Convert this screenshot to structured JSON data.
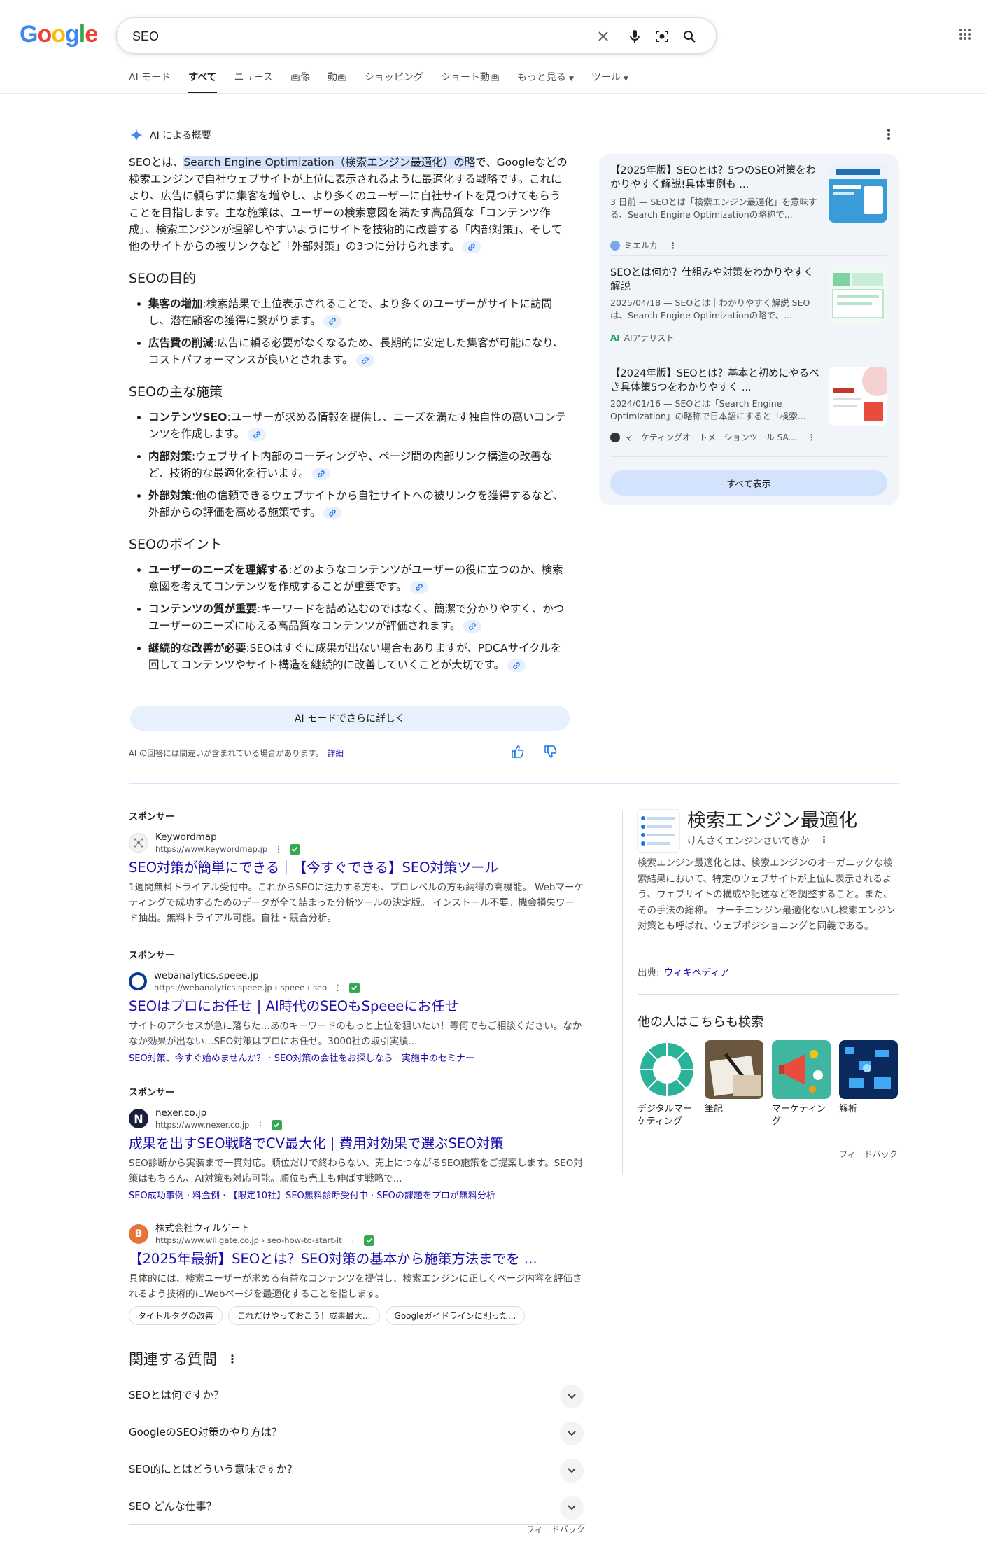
{
  "header": {
    "logo": "Google",
    "query": "SEO",
    "tabs": [
      "AI モード",
      "すべて",
      "ニュース",
      "画像",
      "動画",
      "ショッピング",
      "ショート動画",
      "もっと見る",
      "ツール"
    ]
  },
  "ai_overview": {
    "label": "AI による概要",
    "intro_pre": "SEOとは、",
    "intro_hl": "Search Engine Optimization（検索エンジン最適化）の略",
    "intro_post": "で、Googleなどの検索エンジンで自社ウェブサイトが上位に表示されるように最適化する戦略です。これにより、広告に頼らずに集客を増やし、より多くのユーザーに自社サイトを見つけてもらうことを目指します。主な施策は、ユーザーの検索意図を満たす高品質な「コンテンツ作成」、検索エンジンが理解しやすいようにサイトを技術的に改善する「内部対策」、そして他のサイトからの被リンクなど「外部対策」の3つに分けられます。",
    "sections": [
      {
        "heading": "SEOの目的",
        "items": [
          {
            "term": "集客の増加",
            "text": ":検索結果で上位表示されることで、より多くのユーザーがサイトに訪問し、潜在顧客の獲得に繋がります。"
          },
          {
            "term": "広告費の削減",
            "text": ":広告に頼る必要がなくなるため、長期的に安定した集客が可能になり、コストパフォーマンスが良いとされます。"
          }
        ]
      },
      {
        "heading": "SEOの主な施策",
        "items": [
          {
            "term": "コンテンツSEO",
            "text": ":ユーザーが求める情報を提供し、ニーズを満たす独自性の高いコンテンツを作成します。"
          },
          {
            "term": "内部対策",
            "text": ":ウェブサイト内部のコーディングや、ページ間の内部リンク構造の改善など、技術的な最適化を行います。"
          },
          {
            "term": "外部対策",
            "text": ":他の信頼できるウェブサイトから自社サイトへの被リンクを獲得するなど、外部からの評価を高める施策です。"
          }
        ]
      },
      {
        "heading": "SEOのポイント",
        "items": [
          {
            "term": "ユーザーのニーズを理解する",
            "text": ":どのようなコンテンツがユーザーの役に立つのか、検索意図を考えてコンテンツを作成することが重要です。"
          },
          {
            "term": "コンテンツの質が重要",
            "text": ":キーワードを詰め込むのではなく、簡潔で分かりやすく、かつユーザーのニーズに応える高品質なコンテンツが評価されます。"
          },
          {
            "term": "継続的な改善が必要",
            "text": ":SEOはすぐに成果が出ない場合もありますが、PDCAサイクルを回してコンテンツやサイト構造を継続的に改善していくことが大切です。"
          }
        ]
      }
    ],
    "more_button": "AI モードでさらに詳しく",
    "disclaimer": "AI の回答には間違いが含まれている場合があります。",
    "disclaimer_link": "詳細",
    "sources": [
      {
        "title": "【2025年版】SEOとは？5つのSEO対策をわかりやすく解説!具体事例も ...",
        "snippet": "3 日前 — SEOとは「検索エンジン最適化」を意味する、Search Engine Optimizationの略称で...",
        "site": "ミエルカ"
      },
      {
        "title": "SEOとは何か？仕組みや対策をわかりやすく解説",
        "snippet": "2025/04/18 — SEOとは｜わかりやすく解説 SEOは、Search Engine Optimizationの略で、...",
        "site": "AIアナリスト"
      },
      {
        "title": "【2024年版】SEOとは？基本と初めにやるべき具体策5つをわかりやすく ...",
        "snippet": "2024/01/16 — SEOとは「Search Engine Optimization」の略称で日本語にすると「検索...",
        "site": "マーケティングオートメーションツール SA..."
      }
    ],
    "show_all": "すべて表示"
  },
  "results": [
    {
      "sponsor": "スポンサー",
      "site": "Keywordmap",
      "url": "https://www.keywordmap.jp",
      "title": "SEO対策が簡単にできる｜【今すぐできる】SEO対策ツール",
      "desc": "1週間無料トライアル受付中。これからSEOに注力する方も、プロレベルの方も納得の高機能。 Webマーケティングで成功するためのデータが全て詰まった分析ツールの決定版。 インストール不要。機会損失ワード抽出。無料トライアル可能。自社・競合分析。"
    },
    {
      "sponsor": "スポンサー",
      "site": "webanalytics.speee.jp",
      "url": "https://webanalytics.speee.jp › speee › seo",
      "title": "SEOはプロにお任せ | AI時代のSEOもSpeeeにお任せ",
      "desc": "サイトのアクセスが急に落ちた…あのキーワードのもっと上位を狙いたい！等何でもご相談ください。なかなか効果が出ない…SEO対策はプロにお任せ。3000社の取引実績...",
      "sublinks": [
        "SEO対策、今すぐ始めませんか？",
        "SEO対策の会社をお探しなら",
        "実施中のセミナー"
      ]
    },
    {
      "sponsor": "スポンサー",
      "site": "nexer.co.jp",
      "url": "https://www.nexer.co.jp",
      "title": "成果を出すSEO戦略でCV最大化 | 費用対効果で選ぶSEO対策",
      "desc": "SEO診断から実装まで一貫対応。順位だけで終わらない、売上につながるSEO施策をご提案します。SEO対策はもちろん、AI対策も対応可能。順位も売上も伸ばす戦略で...",
      "sublinks": [
        "SEO成功事例",
        "料金例",
        "【限定10社】SEO無料診断受付中",
        "SEOの課題をプロが無料分析"
      ]
    },
    {
      "site": "株式会社ウィルゲート",
      "url": "https://www.willgate.co.jp › seo-how-to-start-it",
      "title": "【2025年最新】SEOとは？SEO対策の基本から施策方法までを ...",
      "desc": "具体的には、検索ユーザーが求める有益なコンテンツを提供し、検索エンジンに正しくページ内容を評価されるよう技術的にWebページを最適化することを指します。",
      "chips": [
        "タイトルタグの改善",
        "これだけやっておこう！成果最大...",
        "Googleガイドラインに則った..."
      ]
    }
  ],
  "paa": {
    "title": "関連する質問",
    "questions": [
      "SEOとは何ですか？",
      "GoogleのSEO対策のやり方は？",
      "SEO的にとはどういう意味ですか？",
      "SEO どんな仕事？"
    ],
    "feedback": "フィードバック"
  },
  "knowledge_panel": {
    "title": "検索エンジン最適化",
    "reading": "けんさくエンジンさいてきか",
    "description": "検索エンジン最適化とは、検索エンジンのオーガニックな検索結果において、特定のウェブサイトが上位に表示されるよう、ウェブサイトの構成や記述などを調整すること。また、その手法の総称。 サーチエンジン最適化ないし検索エンジン対策とも呼ばれ、ウェブポジショニングと同義である。",
    "source_label": "出典:",
    "source_link": "ウィキペディア",
    "people_also_search": "他の人はこちらも検索",
    "pas_items": [
      "デジタルマーケティング",
      "筆記",
      "マーケティング",
      "解析"
    ],
    "feedback": "フィードバック"
  }
}
